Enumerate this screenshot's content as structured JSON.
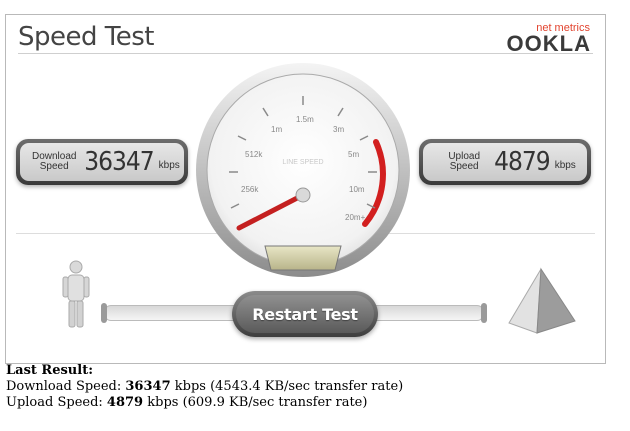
{
  "app": {
    "title": "Speed Test",
    "brand": {
      "subtitle": "net metrics",
      "name": "OOKLA"
    }
  },
  "gauge": {
    "center_label": "LINE SPEED",
    "scale_labels": [
      "256k",
      "512k",
      "1m",
      "1.5m",
      "3m",
      "5m",
      "10m",
      "20m+"
    ],
    "needle_label": "256k"
  },
  "download": {
    "label_line1": "Download",
    "label_line2": "Speed",
    "value": "36347",
    "unit": "kbps"
  },
  "upload": {
    "label_line1": "Upload",
    "label_line2": "Speed",
    "value": "4879",
    "unit": "kbps"
  },
  "restart_button": {
    "label": "Restart Test"
  },
  "last_result": {
    "heading": "Last Result:",
    "download_prefix": "Download Speed: ",
    "download_value": "36347",
    "download_suffix": " kbps (4543.4 KB/sec transfer rate)",
    "upload_prefix": "Upload Speed: ",
    "upload_value": "4879",
    "upload_suffix": " kbps (609.9 KB/sec transfer rate)"
  },
  "colors": {
    "accent": "#e2442f",
    "needle": "#c42020",
    "panel_dark": "#3a3a3a"
  },
  "icons": {
    "person": "person-figure-icon",
    "server": "server-pyramid-icon"
  }
}
